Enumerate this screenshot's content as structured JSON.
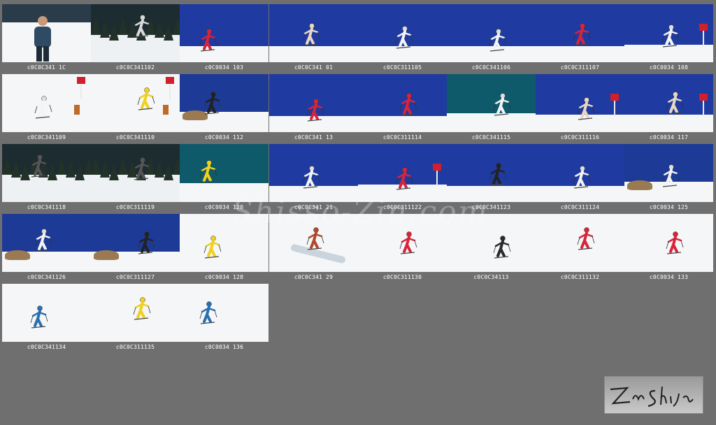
{
  "watermark": "Shisso-Zin.com",
  "signature_text": "Zin Shija",
  "thumbnails": [
    {
      "caption": "c0C0C341 1C",
      "scene": "portrait",
      "suit": "#2f4a63"
    },
    {
      "caption": "c0C0C341102",
      "scene": "forest",
      "suit": "#d9d9d9"
    },
    {
      "caption": "c0C0034 103",
      "scene": "blue",
      "suit": "#d8243a"
    },
    {
      "caption": "c0C0C341 01",
      "scene": "blue",
      "suit": "#e8d7c2"
    },
    {
      "caption": "c0C0C311105",
      "scene": "blue",
      "suit": "#f4f4f4"
    },
    {
      "caption": "c0C0C341106",
      "scene": "blue",
      "suit": "#f4f4f4"
    },
    {
      "caption": "c0C0C311107",
      "scene": "blue",
      "suit": "#d8243a"
    },
    {
      "caption": "c0C0034 108",
      "scene": "flags",
      "suit": "#f4f4f4"
    },
    {
      "caption": "c0C0C341109",
      "scene": "slalom",
      "suit": "#f4f4f4"
    },
    {
      "caption": "c0C0C341110",
      "scene": "slalom",
      "suit": "#f0d020"
    },
    {
      "caption": "c0C0034 112",
      "scene": "rock",
      "suit": "#222222"
    },
    {
      "caption": "c0C0C341 13",
      "scene": "blue",
      "suit": "#d8243a"
    },
    {
      "caption": "c0C0C311114",
      "scene": "blue",
      "suit": "#d8243a"
    },
    {
      "caption": "c0C0C341115",
      "scene": "teal",
      "suit": "#f4f4f4"
    },
    {
      "caption": "c0C0C311116",
      "scene": "flags",
      "suit": "#e8d7c2"
    },
    {
      "caption": "c0C0034 117",
      "scene": "flags",
      "suit": "#e8d7c2"
    },
    {
      "caption": "c0C0C341118",
      "scene": "forest",
      "suit": "#555555"
    },
    {
      "caption": "c0C0C311119",
      "scene": "forest",
      "suit": "#555555"
    },
    {
      "caption": "c0C0034 120",
      "scene": "teal",
      "suit": "#f0d020"
    },
    {
      "caption": "c0C0C341 21",
      "scene": "blue",
      "suit": "#f4f4f4"
    },
    {
      "caption": "c0C0C311122",
      "scene": "flags",
      "suit": "#d8243a"
    },
    {
      "caption": "c0C0C341123",
      "scene": "blue",
      "suit": "#222222"
    },
    {
      "caption": "c0C0C311124",
      "scene": "blue",
      "suit": "#f4f4f4"
    },
    {
      "caption": "c0C0034 125",
      "scene": "rock",
      "suit": "#f4f4f4"
    },
    {
      "caption": "c0C0C341126",
      "scene": "rock",
      "suit": "#f4f4f4"
    },
    {
      "caption": "c0C0C311127",
      "scene": "rock",
      "suit": "#222222"
    },
    {
      "caption": "c0C0034 128",
      "scene": "snow",
      "suit": "#f0d020"
    },
    {
      "caption": "c0C0C341 29",
      "scene": "crowd",
      "suit": "#b04a2a"
    },
    {
      "caption": "c0C0C311130",
      "scene": "snow",
      "suit": "#d8243a"
    },
    {
      "caption": "c0C0C34113",
      "scene": "snow",
      "suit": "#2a2a2a"
    },
    {
      "caption": "c0C0C311132",
      "scene": "snow",
      "suit": "#d8243a"
    },
    {
      "caption": "c0C0034 133",
      "scene": "snow",
      "suit": "#d8243a"
    },
    {
      "caption": "c0C0C341134",
      "scene": "snow",
      "suit": "#2a6fb0"
    },
    {
      "caption": "c0C0C311135",
      "scene": "snow",
      "suit": "#f0d020"
    },
    {
      "caption": "c0C0034 136",
      "scene": "snow",
      "suit": "#2a6fb0"
    }
  ]
}
